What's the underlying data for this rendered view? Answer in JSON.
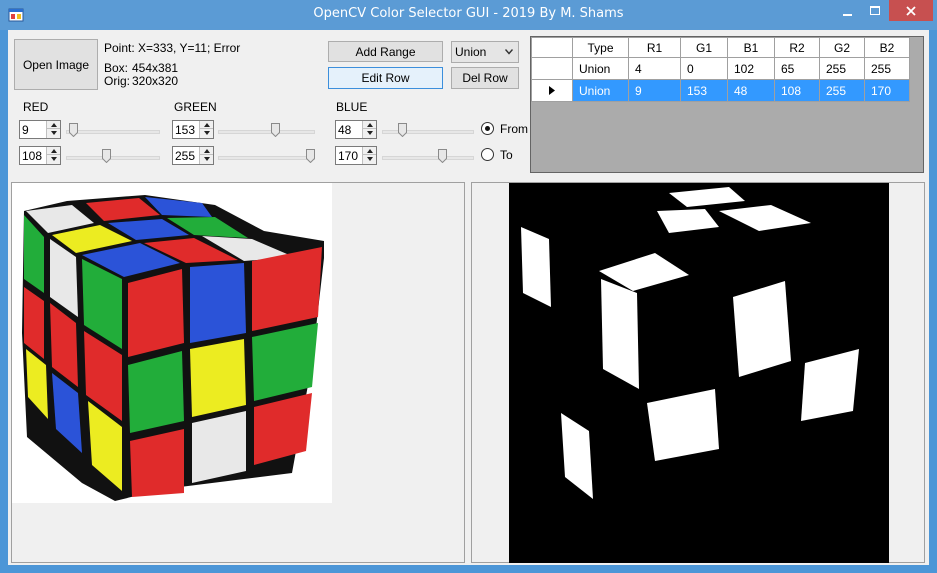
{
  "window": {
    "title": "OpenCV Color Selector GUI - 2019 By M. Shams",
    "app_icon": "app-icon",
    "minimize_icon": "minimize-icon",
    "maximize_icon": "maximize-icon",
    "close_icon": "close-icon"
  },
  "toolbar": {
    "open_image_label": "Open Image",
    "point_text": "Point:  X=333, Y=11; Error",
    "box_label": "Box:",
    "box_value": "454x381",
    "orig_label": "Orig:",
    "orig_value": "320x320",
    "add_range_label": "Add Range",
    "edit_row_label": "Edit Row",
    "del_row_label": "Del Row",
    "mode_select_value": "Union"
  },
  "channels": {
    "red": {
      "label": "RED",
      "from": "9",
      "to": "108",
      "from_frac": 0.03,
      "to_frac": 0.42
    },
    "green": {
      "label": "GREEN",
      "from": "153",
      "to": "255",
      "from_frac": 0.6,
      "to_frac": 1.0
    },
    "blue": {
      "label": "BLUE",
      "from": "48",
      "to": "170",
      "from_frac": 0.19,
      "to_frac": 0.67
    }
  },
  "radio": {
    "from_label": "From",
    "to_label": "To",
    "selected": "From"
  },
  "ranges_table": {
    "headers": [
      "Type",
      "R1",
      "G1",
      "B1",
      "R2",
      "G2",
      "B2"
    ],
    "rows": [
      [
        "Union",
        "4",
        "0",
        "102",
        "65",
        "255",
        "255"
      ],
      [
        "Union",
        "9",
        "153",
        "48",
        "108",
        "255",
        "170"
      ]
    ],
    "selected_row": 1
  },
  "colors": {
    "titlebar": "#5b9bd5",
    "selection": "#3399ff",
    "cube_red": "#e02b2b",
    "cube_green": "#22ad3a",
    "cube_blue": "#2b53d8",
    "cube_yellow": "#ecec21",
    "cube_white": "#e8e8e8"
  }
}
